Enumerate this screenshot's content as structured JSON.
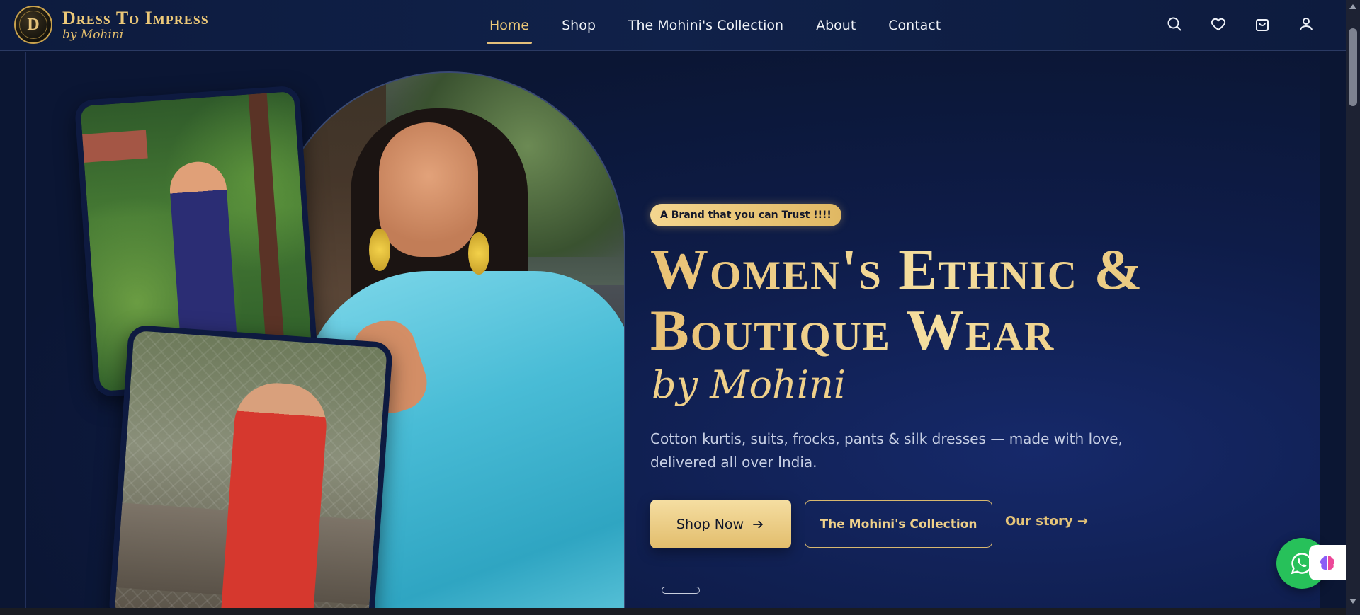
{
  "brand": {
    "logo_letters": "D",
    "title": "Dress To Impress",
    "subtitle": "by Mohini"
  },
  "nav": {
    "items": [
      {
        "label": "Home",
        "active": true
      },
      {
        "label": "Shop",
        "active": false
      },
      {
        "label": "The Mohini's Collection",
        "active": false
      },
      {
        "label": "About",
        "active": false
      },
      {
        "label": "Contact",
        "active": false
      }
    ]
  },
  "tools": {
    "icons": [
      "search-icon",
      "heart-icon",
      "bag-icon",
      "user-icon"
    ]
  },
  "hero": {
    "tagline": "A Brand that you can Trust !!!!",
    "headline_line1": "Women's Ethnic &",
    "headline_line2": "Boutique Wear",
    "byline": "by Mohini",
    "description": "Cotton kurtis, suits, frocks, pants & silk dresses — made with love, delivered all over India.",
    "primary_cta": "Shop Now",
    "secondary_cta": "The Mohini's Collection",
    "story_link": "Our story →"
  },
  "floating": {
    "whatsapp_icon": "whatsapp-icon",
    "assistant_icon": "brain-icon"
  },
  "colors": {
    "accent_gold": "#e4c07a",
    "background_navy": "#0b1633",
    "whatsapp_green": "#27c15a"
  }
}
